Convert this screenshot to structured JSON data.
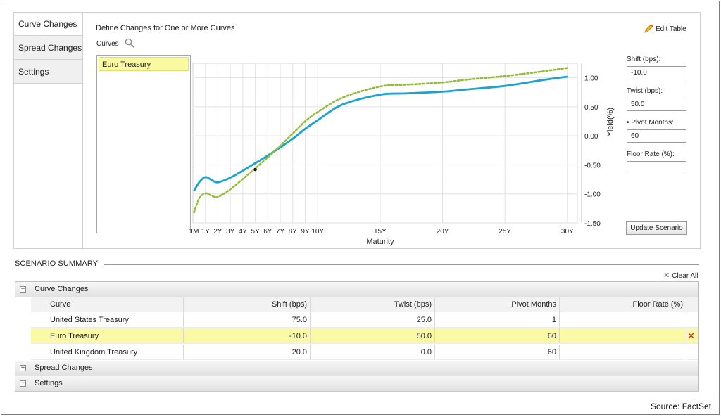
{
  "tabs": [
    {
      "label": "Curve Changes",
      "active": true
    },
    {
      "label": "Spread Changes",
      "active": false
    },
    {
      "label": "Settings",
      "active": false
    }
  ],
  "define_label": "Define Changes for One or More Curves",
  "curves_label": "Curves",
  "curves_list": [
    "Euro Treasury"
  ],
  "edit_table_label": "Edit Table",
  "params": {
    "shift_label": "Shift (bps):",
    "shift_value": "-10.0",
    "twist_label": "Twist (bps):",
    "twist_value": "50.0",
    "pivot_label": "• Pivot Months:",
    "pivot_value": "60",
    "floor_label": "Floor Rate (%):",
    "floor_value": ""
  },
  "update_button": "Update Scenario",
  "chart_data": {
    "type": "line",
    "title": "",
    "xlabel": "Maturity",
    "ylabel": "Yield(%)",
    "ylim": [
      -1.5,
      1.25
    ],
    "y_ticks": [
      "1.00",
      "0.50",
      "0.00",
      "-0.50",
      "-1.00",
      "-1.50"
    ],
    "y_tick_values": [
      1.0,
      0.5,
      0.0,
      -0.5,
      -1.0,
      -1.5
    ],
    "x_ticks": [
      "1M",
      "1Y",
      "2Y",
      "3Y",
      "4Y",
      "5Y",
      "6Y",
      "7Y",
      "8Y",
      "9Y",
      "10Y",
      "15Y",
      "20Y",
      "25Y",
      "30Y"
    ],
    "x_tick_values": [
      0.083,
      1,
      2,
      3,
      4,
      5,
      6,
      7,
      8,
      9,
      10,
      15,
      20,
      25,
      30
    ],
    "xlim": [
      0,
      30.8
    ],
    "grid": true,
    "colors": {
      "base": "#1aa3cf",
      "scenario": "#93bc33"
    },
    "series": [
      {
        "style": "solid",
        "x": [
          0.083,
          0.5,
          1,
          1.5,
          2,
          3,
          4,
          5,
          6,
          7,
          8,
          9,
          10,
          12,
          15,
          17,
          20,
          22,
          25,
          28,
          30
        ],
        "y": [
          -0.95,
          -0.8,
          -0.71,
          -0.76,
          -0.8,
          -0.72,
          -0.6,
          -0.47,
          -0.34,
          -0.2,
          -0.05,
          0.12,
          0.27,
          0.54,
          0.71,
          0.73,
          0.76,
          0.8,
          0.86,
          0.96,
          1.02
        ]
      },
      {
        "style": "dotted",
        "x": [
          0.083,
          0.5,
          1,
          1.5,
          2,
          3,
          4,
          5,
          6,
          7,
          8,
          9,
          10,
          12,
          15,
          17,
          20,
          22,
          25,
          28,
          30
        ],
        "y": [
          -1.32,
          -1.08,
          -0.99,
          -1.03,
          -1.05,
          -0.92,
          -0.74,
          -0.56,
          -0.37,
          -0.17,
          0.04,
          0.25,
          0.41,
          0.66,
          0.85,
          0.88,
          0.92,
          0.97,
          1.03,
          1.11,
          1.17
        ]
      }
    ],
    "marker": {
      "x": 5,
      "y": -0.58
    }
  },
  "summary": {
    "title": "SCENARIO SUMMARY",
    "clear_all": "Clear All",
    "groups": {
      "curve_changes": "Curve Changes",
      "spread_changes": "Spread Changes",
      "settings": "Settings"
    },
    "columns": [
      "Curve",
      "Shift (bps)",
      "Twist (bps)",
      "Pivot Months",
      "Floor Rate (%)"
    ],
    "rows": [
      {
        "curve": "United States Treasury",
        "shift": "75.0",
        "twist": "25.0",
        "pivot": "1",
        "floor": ""
      },
      {
        "curve": "Euro Treasury",
        "shift": "-10.0",
        "twist": "50.0",
        "pivot": "60",
        "floor": ""
      },
      {
        "curve": "United Kingdom Treasury",
        "shift": "20.0",
        "twist": "0.0",
        "pivot": "60",
        "floor": ""
      }
    ]
  },
  "source": "Source: FactSet"
}
